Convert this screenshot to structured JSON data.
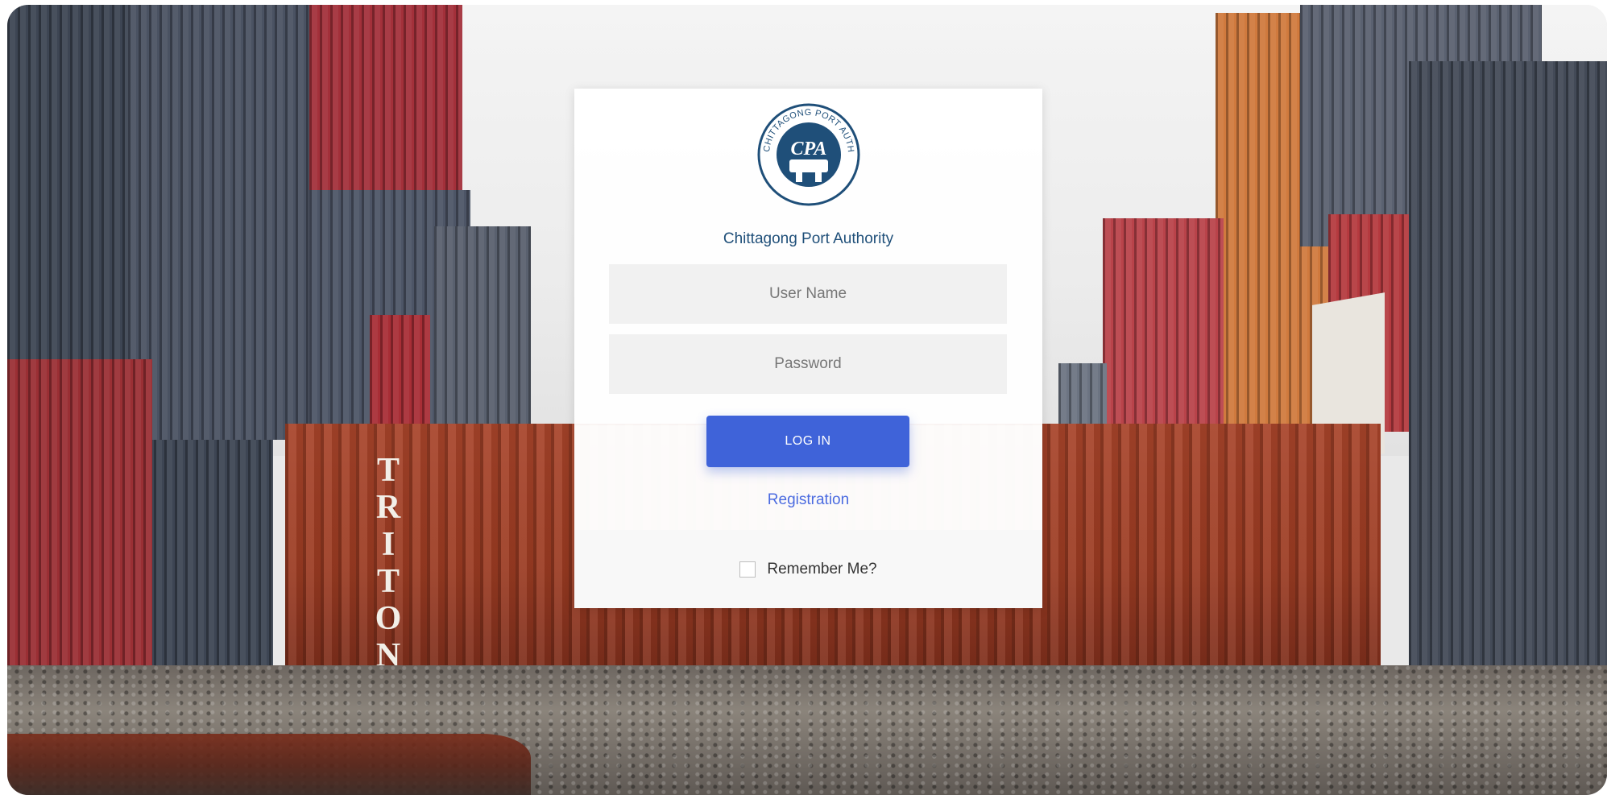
{
  "login": {
    "organization": "Chittagong Port Authority",
    "logo_text": "CHITTAGONG PORT AUTHORITY",
    "logo_mark": "CPA",
    "username_placeholder": "User Name",
    "password_placeholder": "Password",
    "login_label": "LOG IN",
    "registration_label": "Registration",
    "remember_label": "Remember Me?"
  },
  "background": {
    "container_text": "TRITON"
  },
  "colors": {
    "accent": "#3f63d9",
    "org_text": "#1f4f79",
    "link": "#4b6be0"
  }
}
